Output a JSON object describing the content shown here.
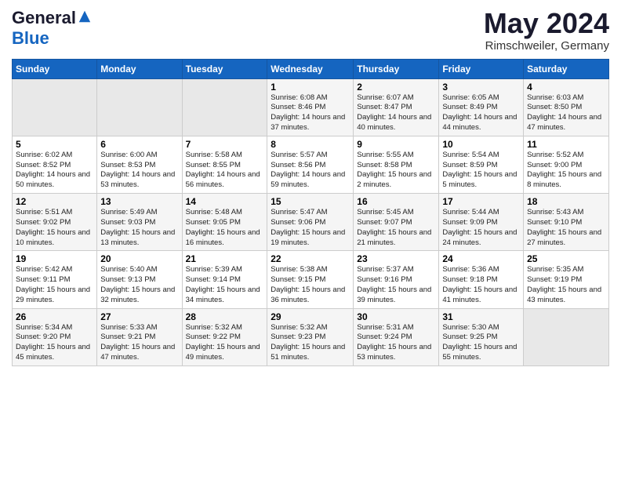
{
  "header": {
    "logo_general": "General",
    "logo_blue": "Blue",
    "month": "May 2024",
    "location": "Rimschweiler, Germany"
  },
  "weekdays": [
    "Sunday",
    "Monday",
    "Tuesday",
    "Wednesday",
    "Thursday",
    "Friday",
    "Saturday"
  ],
  "weeks": [
    [
      {
        "day": "",
        "info": ""
      },
      {
        "day": "",
        "info": ""
      },
      {
        "day": "",
        "info": ""
      },
      {
        "day": "1",
        "info": "Sunrise: 6:08 AM\nSunset: 8:46 PM\nDaylight: 14 hours\nand 37 minutes."
      },
      {
        "day": "2",
        "info": "Sunrise: 6:07 AM\nSunset: 8:47 PM\nDaylight: 14 hours\nand 40 minutes."
      },
      {
        "day": "3",
        "info": "Sunrise: 6:05 AM\nSunset: 8:49 PM\nDaylight: 14 hours\nand 44 minutes."
      },
      {
        "day": "4",
        "info": "Sunrise: 6:03 AM\nSunset: 8:50 PM\nDaylight: 14 hours\nand 47 minutes."
      }
    ],
    [
      {
        "day": "5",
        "info": "Sunrise: 6:02 AM\nSunset: 8:52 PM\nDaylight: 14 hours\nand 50 minutes."
      },
      {
        "day": "6",
        "info": "Sunrise: 6:00 AM\nSunset: 8:53 PM\nDaylight: 14 hours\nand 53 minutes."
      },
      {
        "day": "7",
        "info": "Sunrise: 5:58 AM\nSunset: 8:55 PM\nDaylight: 14 hours\nand 56 minutes."
      },
      {
        "day": "8",
        "info": "Sunrise: 5:57 AM\nSunset: 8:56 PM\nDaylight: 14 hours\nand 59 minutes."
      },
      {
        "day": "9",
        "info": "Sunrise: 5:55 AM\nSunset: 8:58 PM\nDaylight: 15 hours\nand 2 minutes."
      },
      {
        "day": "10",
        "info": "Sunrise: 5:54 AM\nSunset: 8:59 PM\nDaylight: 15 hours\nand 5 minutes."
      },
      {
        "day": "11",
        "info": "Sunrise: 5:52 AM\nSunset: 9:00 PM\nDaylight: 15 hours\nand 8 minutes."
      }
    ],
    [
      {
        "day": "12",
        "info": "Sunrise: 5:51 AM\nSunset: 9:02 PM\nDaylight: 15 hours\nand 10 minutes."
      },
      {
        "day": "13",
        "info": "Sunrise: 5:49 AM\nSunset: 9:03 PM\nDaylight: 15 hours\nand 13 minutes."
      },
      {
        "day": "14",
        "info": "Sunrise: 5:48 AM\nSunset: 9:05 PM\nDaylight: 15 hours\nand 16 minutes."
      },
      {
        "day": "15",
        "info": "Sunrise: 5:47 AM\nSunset: 9:06 PM\nDaylight: 15 hours\nand 19 minutes."
      },
      {
        "day": "16",
        "info": "Sunrise: 5:45 AM\nSunset: 9:07 PM\nDaylight: 15 hours\nand 21 minutes."
      },
      {
        "day": "17",
        "info": "Sunrise: 5:44 AM\nSunset: 9:09 PM\nDaylight: 15 hours\nand 24 minutes."
      },
      {
        "day": "18",
        "info": "Sunrise: 5:43 AM\nSunset: 9:10 PM\nDaylight: 15 hours\nand 27 minutes."
      }
    ],
    [
      {
        "day": "19",
        "info": "Sunrise: 5:42 AM\nSunset: 9:11 PM\nDaylight: 15 hours\nand 29 minutes."
      },
      {
        "day": "20",
        "info": "Sunrise: 5:40 AM\nSunset: 9:13 PM\nDaylight: 15 hours\nand 32 minutes."
      },
      {
        "day": "21",
        "info": "Sunrise: 5:39 AM\nSunset: 9:14 PM\nDaylight: 15 hours\nand 34 minutes."
      },
      {
        "day": "22",
        "info": "Sunrise: 5:38 AM\nSunset: 9:15 PM\nDaylight: 15 hours\nand 36 minutes."
      },
      {
        "day": "23",
        "info": "Sunrise: 5:37 AM\nSunset: 9:16 PM\nDaylight: 15 hours\nand 39 minutes."
      },
      {
        "day": "24",
        "info": "Sunrise: 5:36 AM\nSunset: 9:18 PM\nDaylight: 15 hours\nand 41 minutes."
      },
      {
        "day": "25",
        "info": "Sunrise: 5:35 AM\nSunset: 9:19 PM\nDaylight: 15 hours\nand 43 minutes."
      }
    ],
    [
      {
        "day": "26",
        "info": "Sunrise: 5:34 AM\nSunset: 9:20 PM\nDaylight: 15 hours\nand 45 minutes."
      },
      {
        "day": "27",
        "info": "Sunrise: 5:33 AM\nSunset: 9:21 PM\nDaylight: 15 hours\nand 47 minutes."
      },
      {
        "day": "28",
        "info": "Sunrise: 5:32 AM\nSunset: 9:22 PM\nDaylight: 15 hours\nand 49 minutes."
      },
      {
        "day": "29",
        "info": "Sunrise: 5:32 AM\nSunset: 9:23 PM\nDaylight: 15 hours\nand 51 minutes."
      },
      {
        "day": "30",
        "info": "Sunrise: 5:31 AM\nSunset: 9:24 PM\nDaylight: 15 hours\nand 53 minutes."
      },
      {
        "day": "31",
        "info": "Sunrise: 5:30 AM\nSunset: 9:25 PM\nDaylight: 15 hours\nand 55 minutes."
      },
      {
        "day": "",
        "info": ""
      }
    ]
  ]
}
